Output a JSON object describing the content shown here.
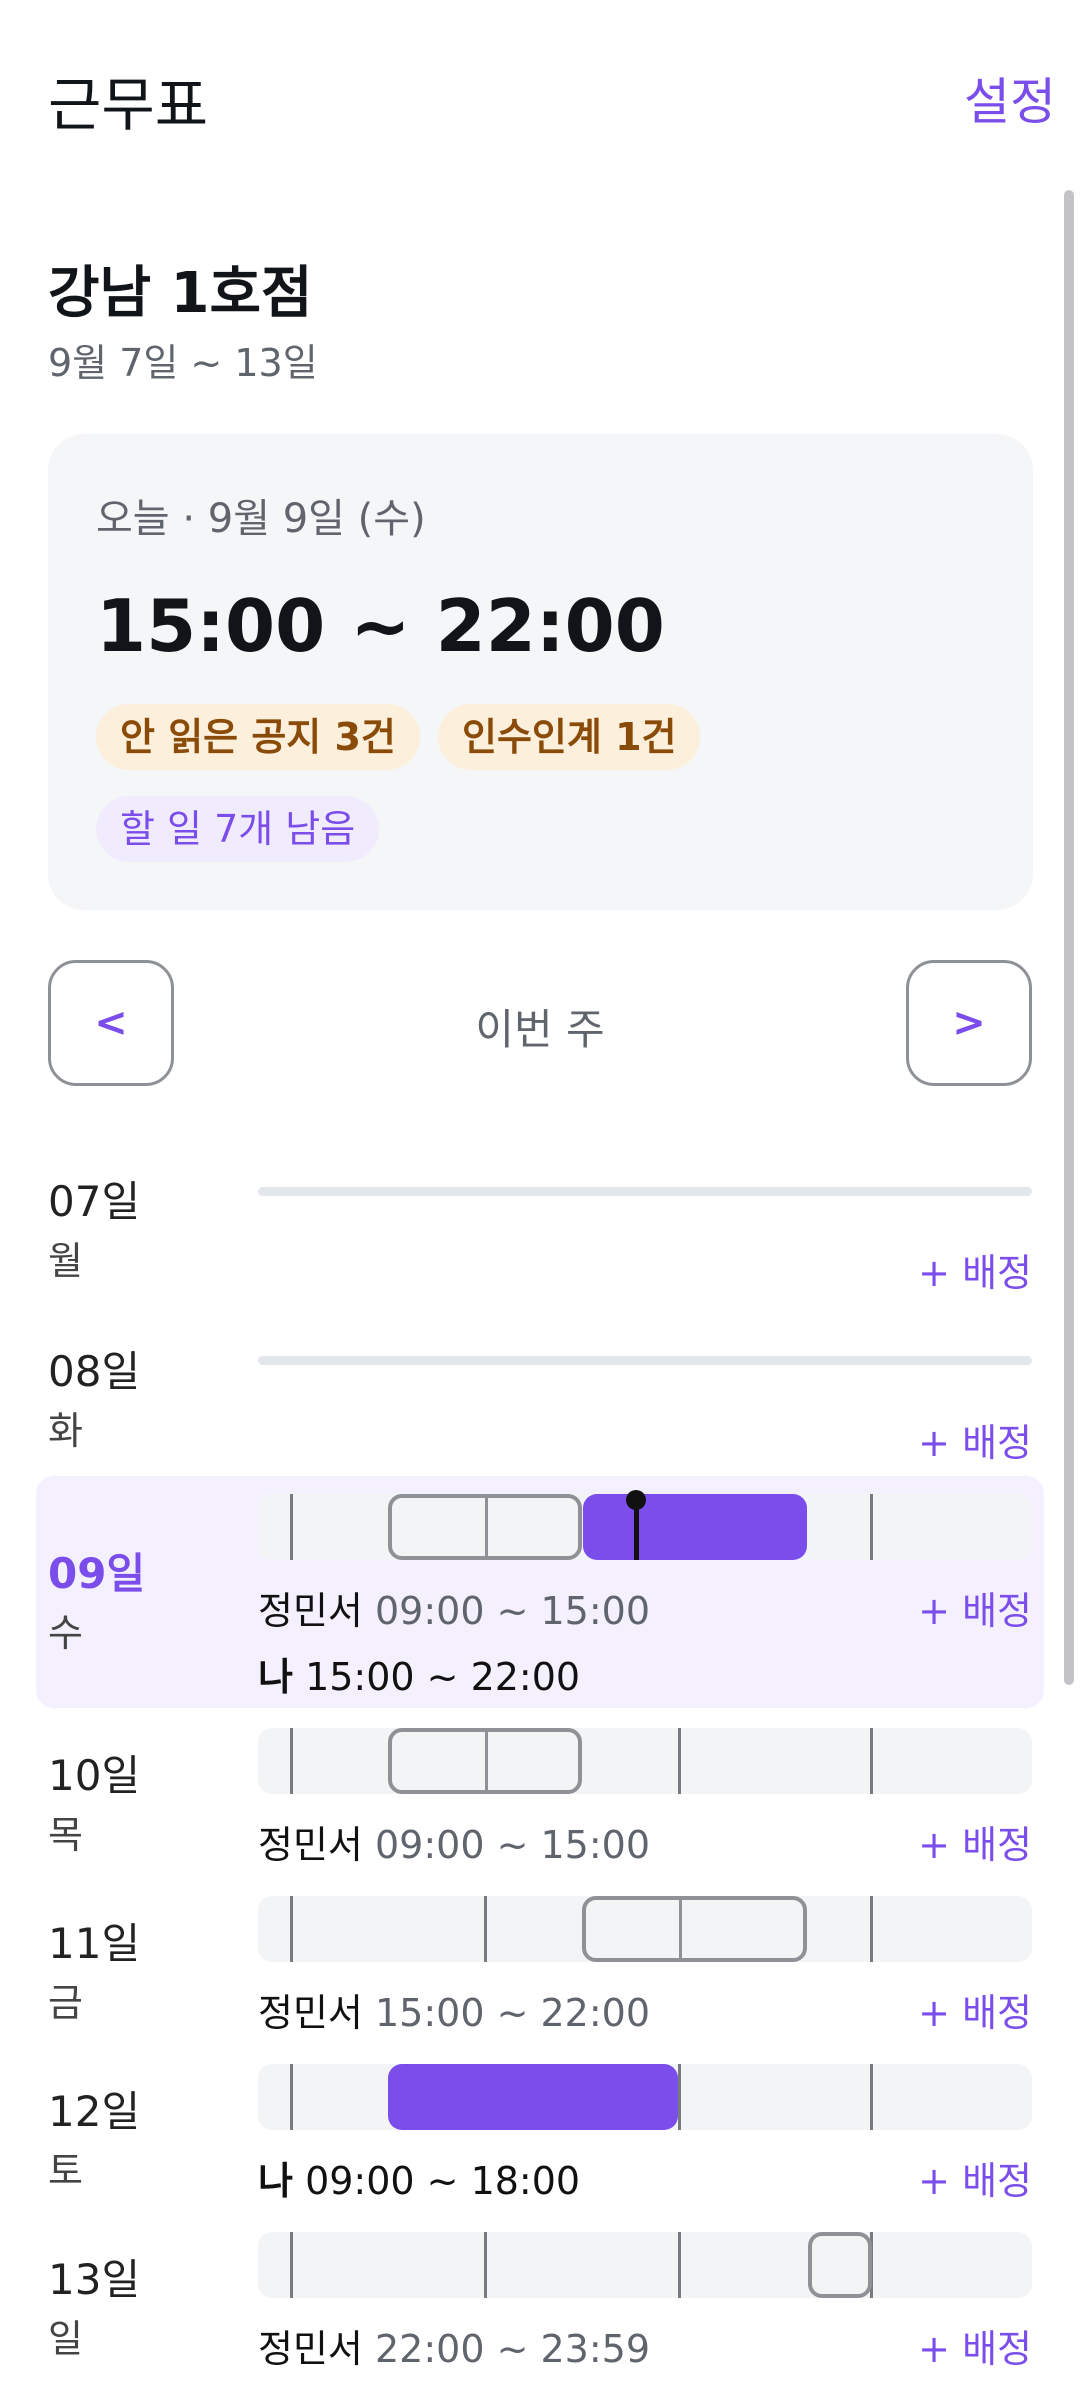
{
  "app": {
    "title": "근무표",
    "settings_label": "설정"
  },
  "store": {
    "name": "강남 1호점",
    "week_range": "9월 7일 ~ 13일"
  },
  "today": {
    "label": "오늘 · 9월 9일 (수)",
    "time": "15:00 ~ 22:00",
    "chips": [
      "안 읽은 공지 3건",
      "인수인계 1건",
      "할 일 7개 남음"
    ]
  },
  "week_nav": {
    "prev": "<",
    "label": "이번 주",
    "next": ">"
  },
  "assign_label": "+ 배정",
  "days": [
    {
      "num": "07일",
      "weekday": "월",
      "shifts": []
    },
    {
      "num": "08일",
      "weekday": "화",
      "shifts": []
    },
    {
      "num": "09일",
      "weekday": "수",
      "highlighted": true,
      "shifts": [
        {
          "name": "정민서",
          "time": "09:00 ~ 15:00",
          "me": false
        },
        {
          "name": "나",
          "time": "15:00 ~ 22:00",
          "me": true
        }
      ]
    },
    {
      "num": "10일",
      "weekday": "목",
      "shifts": [
        {
          "name": "정민서",
          "time": "09:00 ~ 15:00",
          "me": false
        }
      ]
    },
    {
      "num": "11일",
      "weekday": "금",
      "shifts": [
        {
          "name": "정민서",
          "time": "15:00 ~ 22:00",
          "me": false
        }
      ]
    },
    {
      "num": "12일",
      "weekday": "토",
      "shifts": [
        {
          "name": "나",
          "time": "09:00 ~ 18:00",
          "me": true
        }
      ]
    },
    {
      "num": "13일",
      "weekday": "일",
      "shifts": [
        {
          "name": "정민서",
          "time": "22:00 ~ 23:59",
          "me": false
        }
      ]
    }
  ],
  "colors": {
    "accent": "#7b4dea",
    "amber_chip_bg": "#fcefdc",
    "amber_chip_text": "#8a4b08"
  }
}
